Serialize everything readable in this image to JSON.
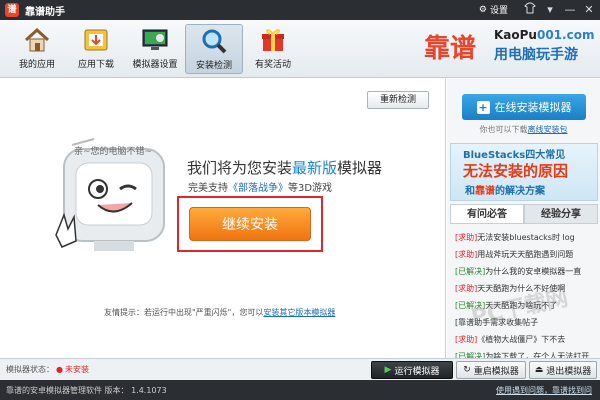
{
  "window": {
    "title": "靠谱助手",
    "settings_label": "设置"
  },
  "toolbar": {
    "items": [
      {
        "label": "我的应用"
      },
      {
        "label": "应用下载"
      },
      {
        "label": "模拟器设置"
      },
      {
        "label": "安装检测"
      },
      {
        "label": "有奖活动"
      }
    ],
    "active_index": 3
  },
  "brand": {
    "logo_text": "靠谱",
    "url_prefix": "KaoPu",
    "url_suffix": "001.com",
    "slogan": "用电脑玩手游"
  },
  "main": {
    "recheck_label": "重新检测",
    "bubble_text": "亲~您的电脑不错~",
    "headline_prefix": "我们将为您安装",
    "headline_highlight": "最新版",
    "headline_suffix": "模拟器",
    "support_prefix": "完美支持",
    "support_link": "《部落战争》",
    "support_suffix": "等3D游戏",
    "install_label": "继续安装",
    "tip_prefix": "友情提示：若运行中出现\"严重闪烁\"，您可以",
    "tip_link": "安装其它版本模拟器"
  },
  "sidebar": {
    "online_install_label": "在线安装模拟器",
    "hint_prefix": "你也可以下载",
    "hint_link": "离线安装包",
    "banner": {
      "line1": "BlueStacks四大常见",
      "line2": "无法安装的原因",
      "line3_prefix": "和",
      "line3_highlight": "靠谱",
      "line3_suffix": "的解决方案"
    },
    "tabs": [
      "有问必答",
      "经验分享"
    ],
    "active_tab": 0,
    "news": [
      {
        "tag": "[求助]",
        "solved": false,
        "text": "无法安装bluestacks时 log"
      },
      {
        "tag": "[求助]",
        "solved": false,
        "text": "用战斧玩天天酷跑遇到问题"
      },
      {
        "tag": "[已解决]",
        "solved": true,
        "text": "为什么我的安卓模拟器一直"
      },
      {
        "tag": "[求助]",
        "solved": false,
        "text": "天天酷跑为什么不好使啊"
      },
      {
        "tag": "[已解决]",
        "solved": true,
        "text": "天天酷跑为啥玩不了"
      },
      {
        "tag": "",
        "solved": false,
        "text": "[靠谱助手需求收集帖子"
      },
      {
        "tag": "[求助]",
        "solved": false,
        "text": "《植物大战僵尸》下不去"
      },
      {
        "tag": "[已解决]",
        "solved": true,
        "text": "为啥下载了，在个人无法打开"
      }
    ]
  },
  "statusbar": {
    "status_label": "模拟器状态：",
    "status_value": "未安装",
    "run_label": "运行模拟器",
    "restart_label": "重启模拟器",
    "exit_label": "退出模拟器"
  },
  "footer": {
    "left_text": "靠谱的安卓模拟器管理软件   版本： 1.4.1073",
    "right_text": "使用遇到问题，靠谱找到问"
  },
  "watermark": "PC下载网"
}
